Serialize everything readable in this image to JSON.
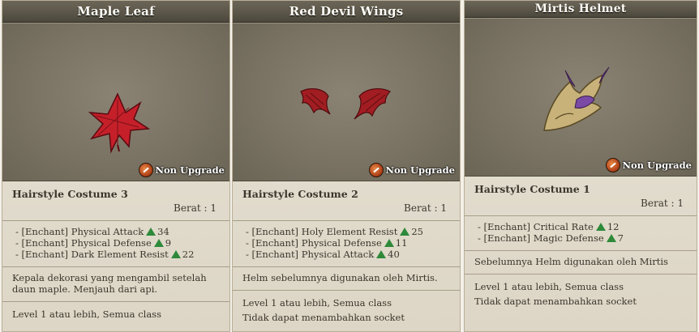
{
  "cards": [
    {
      "title": "Maple Leaf",
      "badge": "Non Upgrade",
      "type": "Hairstyle Costume 3",
      "weight": "Berat : 1",
      "stats": [
        {
          "label": "- [Enchant] Physical Attack",
          "value": "34"
        },
        {
          "label": "- [Enchant] Physical Defense",
          "value": "9"
        },
        {
          "label": "- [Enchant] Dark Element Resist",
          "value": "22"
        }
      ],
      "description": "Kepala dekorasi yang mengambil setelah daun maple. Menjauh dari api.",
      "requirement": "Level 1 atau lebih, Semua class",
      "icon": "maple-leaf-icon"
    },
    {
      "title": "Red Devil Wings",
      "badge": "Non Upgrade",
      "type": "Hairstyle Costume 2",
      "weight": "Berat : 1",
      "stats": [
        {
          "label": "- [Enchant] Holy Element Resist",
          "value": "25"
        },
        {
          "label": "- [Enchant] Physical Defense",
          "value": "11"
        },
        {
          "label": "- [Enchant] Physical Attack",
          "value": "40"
        }
      ],
      "description": "Helm sebelumnya digunakan oleh Mirtis.",
      "requirement": "Level 1 atau lebih, Semua class",
      "socket": "Tidak dapat menambahkan socket",
      "icon": "devil-wings-icon"
    },
    {
      "title": "Mirtis Helmet",
      "badge": "Non Upgrade",
      "type": "Hairstyle Costume 1",
      "weight": "Berat : 1",
      "stats": [
        {
          "label": "- [Enchant] Critical Rate",
          "value": "12"
        },
        {
          "label": "- [Enchant] Magic Defense",
          "value": "7"
        }
      ],
      "description": "Sebelumnya Helm digunakan oleh Mirtis",
      "requirement": "Level 1 atau lebih, Semua class",
      "socket": "Tidak dapat menambahkan socket",
      "icon": "helmet-icon"
    }
  ]
}
